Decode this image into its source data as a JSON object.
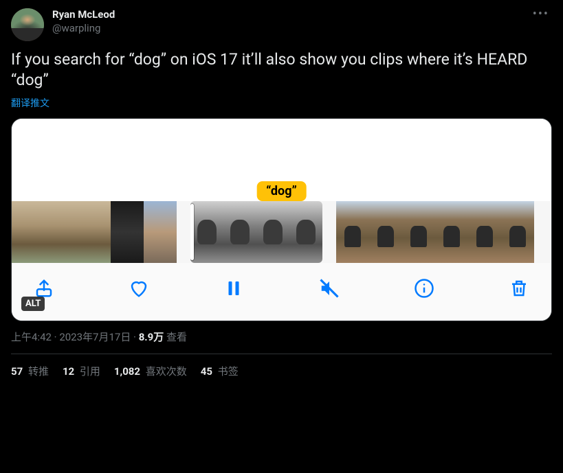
{
  "author": {
    "display_name": "Ryan McLeod",
    "handle": "@warpling"
  },
  "tweet_text": "If you search for “dog” on iOS 17 it’ll also show you clips where it’s HEARD “dog”",
  "translate_label": "翻译推文",
  "media": {
    "search_badge": "“dog”",
    "alt_badge": "ALT",
    "toolbar_icons": {
      "share": "share-icon",
      "like": "heart-icon",
      "pause": "pause-icon",
      "mute": "mute-icon",
      "info": "info-icon",
      "trash": "trash-icon"
    }
  },
  "meta": {
    "time": "上午4:42",
    "date": "2023年7月17日",
    "views_count": "8.9万",
    "views_label": " 查看",
    "separator": " · "
  },
  "stats": {
    "retweets": {
      "count": "57",
      "label": " 转推"
    },
    "quotes": {
      "count": "12",
      "label": " 引用"
    },
    "likes": {
      "count": "1,082",
      "label": " 喜欢次数"
    },
    "bookmarks": {
      "count": "45",
      "label": " 书签"
    }
  }
}
